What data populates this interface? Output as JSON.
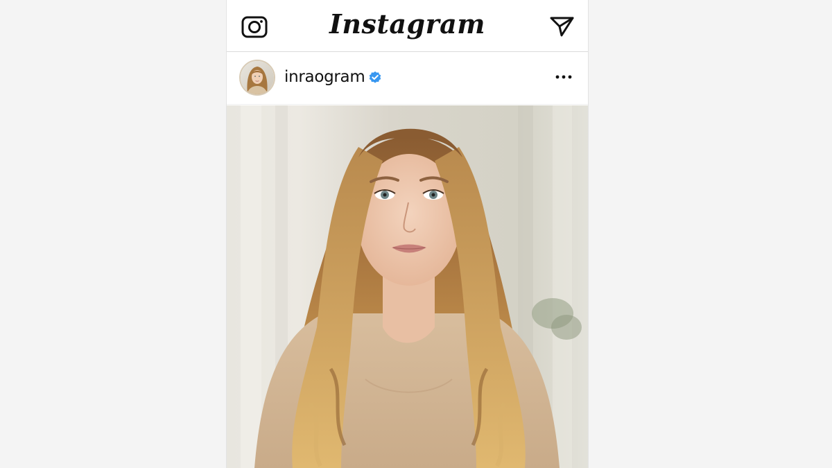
{
  "app": {
    "logo_text": "Instagram",
    "topbar": {
      "left_icon": "camera-icon",
      "right_icon": "send-icon"
    }
  },
  "post": {
    "username": "inraogram",
    "verified": true,
    "verified_color": "#3897f0",
    "more_icon": "more-horizontal-icon",
    "image_description_icon": "photo-portrait"
  },
  "colors": {
    "background": "#f4f4f4",
    "panel": "#ffffff",
    "text": "#111111",
    "divider": "#dbdbdb"
  }
}
